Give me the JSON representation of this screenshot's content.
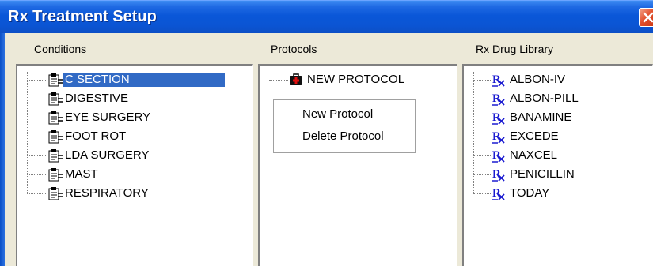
{
  "window": {
    "title": "Rx Treatment Setup"
  },
  "conditions": {
    "label": "Conditions",
    "items": [
      {
        "label": "C SECTION",
        "selected": true
      },
      {
        "label": "DIGESTIVE"
      },
      {
        "label": "EYE SURGERY"
      },
      {
        "label": "FOOT ROT"
      },
      {
        "label": "LDA SURGERY"
      },
      {
        "label": "MAST"
      },
      {
        "label": "RESPIRATORY"
      }
    ]
  },
  "protocols": {
    "label": "Protocols",
    "items": [
      {
        "label": "NEW PROTOCOL"
      }
    ],
    "context_menu": [
      {
        "label": "New Protocol"
      },
      {
        "label": "Delete Protocol"
      }
    ]
  },
  "drug_library": {
    "label": "Rx Drug Library",
    "items": [
      {
        "label": "ALBON-IV"
      },
      {
        "label": "ALBON-PILL"
      },
      {
        "label": "BANAMINE"
      },
      {
        "label": "EXCEDE"
      },
      {
        "label": "NAXCEL"
      },
      {
        "label": "PENICILLIN"
      },
      {
        "label": "TODAY"
      }
    ]
  },
  "colors": {
    "selection": "#316ac5",
    "titlebar": "#0a57d8",
    "client": "#ece9d8"
  },
  "icons": {
    "condition": "clipboard-icon",
    "protocol": "medical-bag-icon",
    "drug": "rx-icon"
  }
}
